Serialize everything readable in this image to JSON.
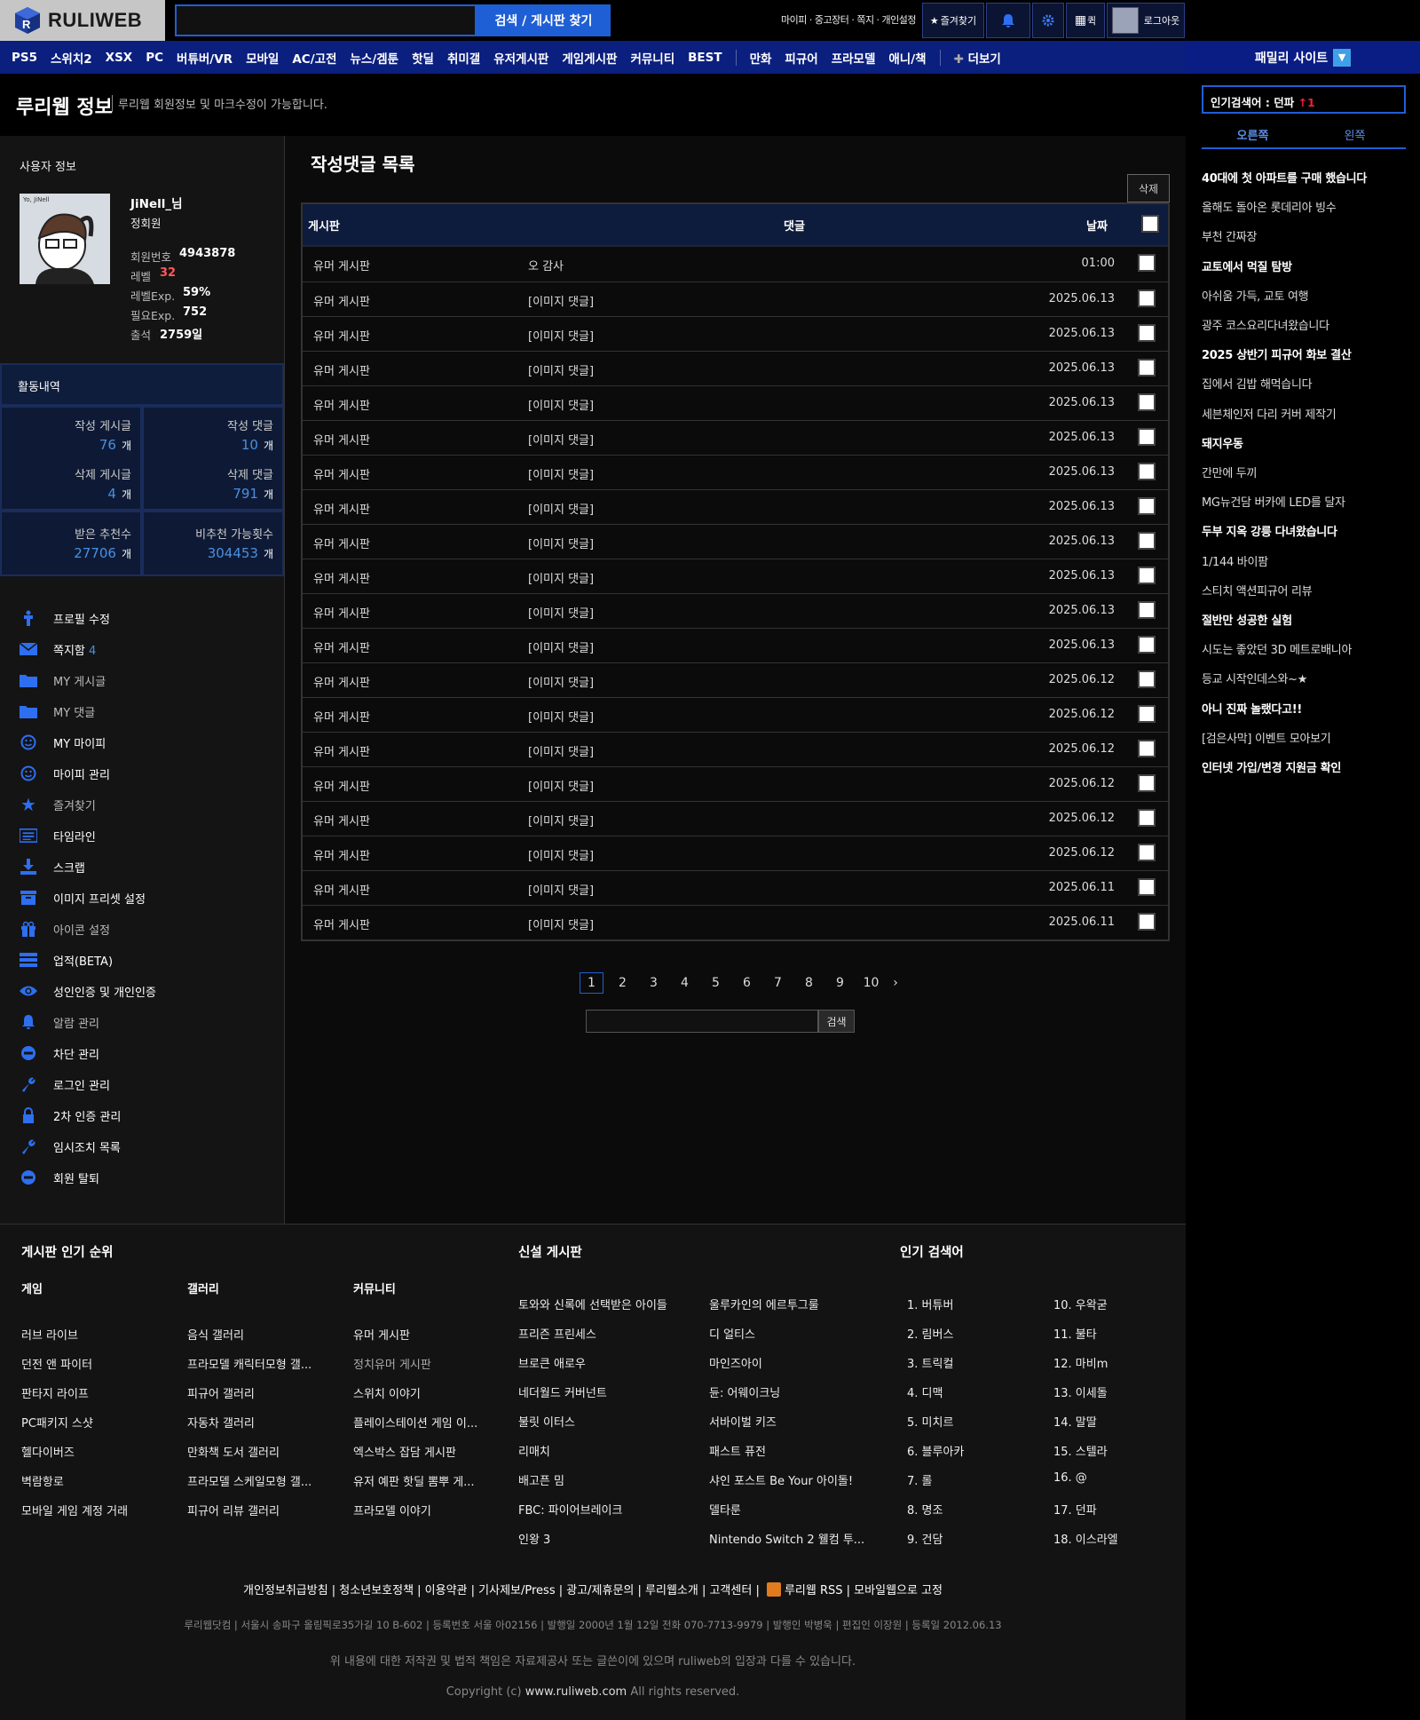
{
  "header": {
    "logo_text": "RULIWEB",
    "search_placeholder": "",
    "search_button": "검색 / 게시판 찾기",
    "top_links": "마이피 · 중고장터 · 쪽지 · 개인설정",
    "favorites": "즐겨찾기",
    "apps_label": "퀵",
    "logout": "로그아웃"
  },
  "nav": {
    "items": [
      "PS5",
      "스위치2",
      "XSX",
      "PC",
      "버튜버/VR",
      "모바일",
      "AC/고전",
      "뉴스/겜툰",
      "핫딜",
      "취미갤",
      "유저게시판",
      "게임게시판",
      "커뮤니티",
      "BEST",
      "만화",
      "피규어",
      "프라모델",
      "애니/책",
      "더보기"
    ],
    "family": "패밀리 사이트"
  },
  "page": {
    "title": "루리웹 정보",
    "subtitle": "루리웹 회원정보 및 마크수정이 가능합니다."
  },
  "user": {
    "section_title": "사용자 정보",
    "nickname": "JiNell_님",
    "grade": "정회원",
    "fields": [
      {
        "label": "회원번호",
        "value": "4943878"
      },
      {
        "label": "레벨",
        "value": "32"
      },
      {
        "label": "레벨Exp.",
        "value": "59%"
      },
      {
        "label": "필요Exp.",
        "value": "752"
      },
      {
        "label": "출석",
        "value": "2759일"
      }
    ]
  },
  "activity": {
    "title": "활동내역",
    "unit": "개",
    "stats": [
      {
        "label": "작성 게시글",
        "value": "76"
      },
      {
        "label": "작성 댓글",
        "value": "10"
      },
      {
        "label": "삭제 게시글",
        "value": "4"
      },
      {
        "label": "삭제 댓글",
        "value": "791"
      },
      {
        "label": "받은 추천수",
        "value": "27706"
      },
      {
        "label": "비추천 가능횟수",
        "value": "304453"
      }
    ]
  },
  "menu": [
    {
      "label": "프로필 수정",
      "icon": "person-icon",
      "bold": true
    },
    {
      "label": "쪽지함",
      "icon": "envelope-icon",
      "count": "4",
      "bold": true
    },
    {
      "label": "MY 게시글",
      "icon": "folder-icon",
      "bold": false
    },
    {
      "label": "MY 댓글",
      "icon": "folder-icon",
      "bold": false
    },
    {
      "label": "MY 마이피",
      "icon": "smile-icon",
      "bold": true
    },
    {
      "label": "마이피 관리",
      "icon": "smile-icon",
      "bold": true
    },
    {
      "label": "즐겨찾기",
      "icon": "star-icon",
      "bold": false
    },
    {
      "label": "타임라인",
      "icon": "list-icon",
      "bold": true
    },
    {
      "label": "스크랩",
      "icon": "download-icon",
      "bold": true
    },
    {
      "label": "이미지 프리셋 설정",
      "icon": "archive-icon",
      "bold": true
    },
    {
      "label": "아이콘 설정",
      "icon": "gift-icon",
      "bold": false
    },
    {
      "label": "업적(BETA)",
      "icon": "stack-icon",
      "bold": true
    },
    {
      "label": "성인인증 및 개인인증",
      "icon": "eye-icon",
      "bold": true
    },
    {
      "label": "알람 관리",
      "icon": "bell-icon",
      "bold": false
    },
    {
      "label": "차단 관리",
      "icon": "minus-circle-icon",
      "bold": true
    },
    {
      "label": "로그인 관리",
      "icon": "wrench-icon",
      "bold": true
    },
    {
      "label": "2차 인증 관리",
      "icon": "lock-icon",
      "bold": true
    },
    {
      "label": "임시조치 목록",
      "icon": "wrench-icon",
      "bold": true
    },
    {
      "label": "회원 탈퇴",
      "icon": "minus-circle-icon",
      "bold": true
    }
  ],
  "comments": {
    "title": "작성댓글 목록",
    "delete_button": "삭제",
    "columns": [
      "게시판",
      "댓글",
      "날짜"
    ],
    "rows": [
      {
        "board": "유머 게시판",
        "comment": "오 감사",
        "date": "01:00"
      },
      {
        "board": "유머 게시판",
        "comment": "[이미지 댓글]",
        "date": "2025.06.13"
      },
      {
        "board": "유머 게시판",
        "comment": "[이미지 댓글]",
        "date": "2025.06.13"
      },
      {
        "board": "유머 게시판",
        "comment": "[이미지 댓글]",
        "date": "2025.06.13"
      },
      {
        "board": "유머 게시판",
        "comment": "[이미지 댓글]",
        "date": "2025.06.13"
      },
      {
        "board": "유머 게시판",
        "comment": "[이미지 댓글]",
        "date": "2025.06.13"
      },
      {
        "board": "유머 게시판",
        "comment": "[이미지 댓글]",
        "date": "2025.06.13"
      },
      {
        "board": "유머 게시판",
        "comment": "[이미지 댓글]",
        "date": "2025.06.13"
      },
      {
        "board": "유머 게시판",
        "comment": "[이미지 댓글]",
        "date": "2025.06.13"
      },
      {
        "board": "유머 게시판",
        "comment": "[이미지 댓글]",
        "date": "2025.06.13"
      },
      {
        "board": "유머 게시판",
        "comment": "[이미지 댓글]",
        "date": "2025.06.13"
      },
      {
        "board": "유머 게시판",
        "comment": "[이미지 댓글]",
        "date": "2025.06.13"
      },
      {
        "board": "유머 게시판",
        "comment": "[이미지 댓글]",
        "date": "2025.06.12"
      },
      {
        "board": "유머 게시판",
        "comment": "[이미지 댓글]",
        "date": "2025.06.12"
      },
      {
        "board": "유머 게시판",
        "comment": "[이미지 댓글]",
        "date": "2025.06.12"
      },
      {
        "board": "유머 게시판",
        "comment": "[이미지 댓글]",
        "date": "2025.06.12"
      },
      {
        "board": "유머 게시판",
        "comment": "[이미지 댓글]",
        "date": "2025.06.12"
      },
      {
        "board": "유머 게시판",
        "comment": "[이미지 댓글]",
        "date": "2025.06.12"
      },
      {
        "board": "유머 게시판",
        "comment": "[이미지 댓글]",
        "date": "2025.06.11"
      },
      {
        "board": "유머 게시판",
        "comment": "[이미지 댓글]",
        "date": "2025.06.11"
      }
    ],
    "pages": [
      "1",
      "2",
      "3",
      "4",
      "5",
      "6",
      "7",
      "8",
      "9",
      "10"
    ],
    "current_page": "1",
    "search_button": "검색"
  },
  "popular": {
    "label": "인기검색어 : 던파",
    "rank_change": "↑1",
    "tabs": [
      "오른쪽",
      "왼쪽"
    ],
    "keywords": [
      {
        "text": "40대에 첫 아파트를 구매 했습니다",
        "bold": true
      },
      {
        "text": "올해도 돌아온 롯데리아 빙수",
        "bold": false
      },
      {
        "text": "부천 간짜장",
        "bold": false
      },
      {
        "text": "교토에서 먹질 탐방",
        "bold": true
      },
      {
        "text": "아쉬움 가득, 교토 여행",
        "bold": false
      },
      {
        "text": "광주 코스요리다녀왔습니다",
        "bold": false
      },
      {
        "text": "2025 상반기 피규어 화보 결산",
        "bold": true
      },
      {
        "text": "집에서 김밥 해먹습니다",
        "bold": false
      },
      {
        "text": "세븐체인저 다리 커버 제작기",
        "bold": false
      },
      {
        "text": "돼지우동",
        "bold": true
      },
      {
        "text": "간만에 두끼",
        "bold": false
      },
      {
        "text": "MG뉴건담 버카에 LED를 달자",
        "bold": false
      },
      {
        "text": "두부 지옥 강릉 다녀왔습니다",
        "bold": true
      },
      {
        "text": "1/144 바이팜",
        "bold": false
      },
      {
        "text": "스티치 액션피규어 리뷰",
        "bold": false
      },
      {
        "text": "절반만 성공한 실험",
        "bold": true
      },
      {
        "text": "시도는 좋았던 3D 메트로배니아",
        "bold": false
      },
      {
        "text": "등교 시작인데스와~★",
        "bold": false
      },
      {
        "text": "아니 진짜 놀랬다고!!",
        "bold": true
      },
      {
        "text": "[검은사막] 이벤트 모아보기",
        "bold": false
      },
      {
        "text": "인터넷 가입/변경 지원금 확인",
        "bold": true
      }
    ]
  },
  "footer": {
    "ranking_title": "게시판 인기 순위",
    "cols": [
      {
        "title": "게임",
        "items": [
          "러브 라이브",
          "던전 앤 파이터",
          "판타지 라이프",
          "PC패키지 스샷",
          "헬다이버즈",
          "벽람항로",
          "모바일 게임 계정 거래"
        ]
      },
      {
        "title": "갤러리",
        "items": [
          "음식 갤러리",
          "프라모델 캐릭터모형 갤...",
          "피규어 갤러리",
          "자동차 갤러리",
          "만화책 도서 갤러리",
          "프라모델 스케일모형 갤...",
          "피규어 리뷰 갤러리"
        ]
      },
      {
        "title": "커뮤니티",
        "items": [
          "유머 게시판",
          "정치유머 게시판",
          "스위치 이야기",
          "플레이스테이션 게임 이...",
          "엑스박스 잡담 게시판",
          "유저 예판 핫딜 뽐뿌 게...",
          "프라모델 이야기"
        ]
      }
    ],
    "new_title": "신설 게시판",
    "new_boards": [
      "토와와 신록에 선택받은 아이들",
      "울루카인의 에르투그룰",
      "프리즌 프린세스",
      "디 얼티스",
      "브로큰 애로우",
      "마인즈아이",
      "네더월드 커버넌트",
      "듄: 어웨이크닝",
      "불릿 이터스",
      "서바이벌 키즈",
      "리매치",
      "패스트 퓨전",
      "배고픈 밈",
      "샤인 포스트 Be Your 아이돌!",
      "FBC: 파이어브레이크",
      "델타룬",
      "인왕 3",
      "Nintendo Switch 2 웰컴 투..."
    ],
    "search_title": "인기 검색어",
    "search_terms": [
      "1. 버튜버",
      "2. 림버스",
      "3. 트릭컬",
      "4. 디맥",
      "5. 미치르",
      "6. 블루아카",
      "7. 롤",
      "8. 명조",
      "9. 건담",
      "10. 우왁굳",
      "11. 불타",
      "12. 마비m",
      "13. 이세돌",
      "14. 말딸",
      "15. 스텔라",
      "16. @",
      "17. 던파",
      "18. 이스라엘"
    ],
    "links": "개인정보취급방침 | 청소년보호정책 | 이용약관 | 기사제보/Press | 광고/제휴문의 | 루리웹소개 | 고객센터 |",
    "rss": "루리웹 RSS",
    "mobile": "| 모바일웹으로 고정",
    "info": "루리웹닷컴 | 서울시 송파구 올림픽로35가길 10 B-602 | 등록번호 서울 아02156 | 발행일 2000년 1월 12일 전화 070-7713-9979 | 발행인 박병욱 | 편집인 이장원 | 등록일 2012.06.13",
    "note": "위 내용에 대한 저작권 및 법적 책임은 자료제공사 또는 글쓴이에 있으며 ruliweb의 입장과 다를 수 있습니다.",
    "copy_prefix": "Copyright (c)",
    "copy_site": "www.ruliweb.com",
    "copy_suffix": "All rights reserved."
  },
  "colors": {
    "accent": "#1f5fd6",
    "nav": "#0b1f7e",
    "stat_value": "#4a8fe0",
    "level": "#ff5a5a"
  }
}
